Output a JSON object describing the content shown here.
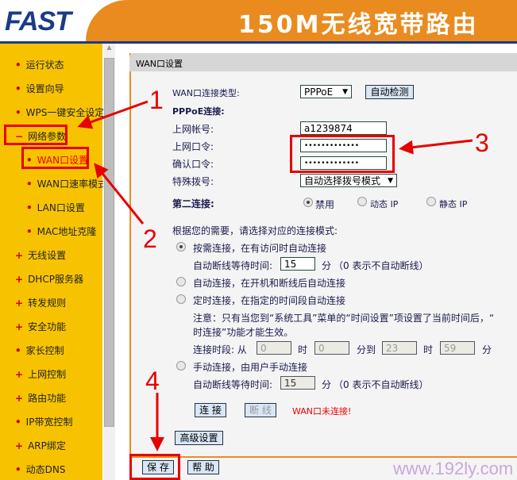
{
  "header": {
    "logo": "FAST",
    "slogan": "150M无线宽带路由"
  },
  "sidebar": {
    "items": [
      {
        "label": "运行状态",
        "bullet": "•"
      },
      {
        "label": "设置向导",
        "bullet": "•"
      },
      {
        "label": "WPS一键安全设定",
        "bullet": "•"
      },
      {
        "label": "网络参数",
        "bullet": "−"
      },
      {
        "label": "WAN口设置",
        "bullet": "•"
      },
      {
        "label": "WAN口速率模式",
        "bullet": "•"
      },
      {
        "label": "LAN口设置",
        "bullet": "•"
      },
      {
        "label": "MAC地址克隆",
        "bullet": "•"
      },
      {
        "label": "无线设置",
        "bullet": "+"
      },
      {
        "label": "DHCP服务器",
        "bullet": "+"
      },
      {
        "label": "转发规则",
        "bullet": "+"
      },
      {
        "label": "安全功能",
        "bullet": "+"
      },
      {
        "label": "家长控制",
        "bullet": "•"
      },
      {
        "label": "上网控制",
        "bullet": "+"
      },
      {
        "label": "路由功能",
        "bullet": "+"
      },
      {
        "label": "IP带宽控制",
        "bullet": "•"
      },
      {
        "label": "ARP绑定",
        "bullet": "+"
      },
      {
        "label": "动态DNS",
        "bullet": "•"
      }
    ]
  },
  "panel": {
    "title": "WAN口设置",
    "conn_type_label": "WAN口连接类型:",
    "conn_type_value": "PPPoE",
    "auto_detect": "自动检测",
    "pppoe_label": "PPPoE连接:",
    "account_label": "上网帐号:",
    "account_value": "a1239874",
    "password_label": "上网口令:",
    "password_value": "•••••••••••••",
    "confirm_label": "确认口令:",
    "confirm_value": "•••••••••••••",
    "special_label": "特殊拨号:",
    "special_value": "自动选择拨号模式",
    "second_label": "第二连接:",
    "second_options": [
      "禁用",
      "动态 IP",
      "静态 IP"
    ],
    "mode_prompt": "根据您的需要，请选择对应的连接模式:",
    "mode1": "按需连接，在有访问时自动连接",
    "wait_label": "自动断线等待时间:",
    "wait1": "15",
    "min": "分",
    "wait_note": "（0 表示不自动断线）",
    "mode2": "自动连接，在开机和断线后自动连接",
    "mode3": "定时连接，在指定的时间段自动连接",
    "note1": "注意：只有当您到“系统工具”菜单的“时间设置”项设置了当前时间后，“",
    "note2": "时连接”功能才能生效。",
    "period_label": "连接时段: 从",
    "from_h": "0",
    "hour": "时",
    "from_m": "0",
    "min_to": "分到",
    "to_h": "23",
    "to_m": "59",
    "mode4": "手动连接，由用户手动连接",
    "wait4": "15",
    "connect": "连 接",
    "disconnect": "断 线",
    "status": "WAN口未连接!",
    "advanced": "高级设置"
  },
  "footer": {
    "save": "保 存",
    "help": "帮 助",
    "watermark": "www.192ly.com"
  },
  "annotations": {
    "n1": "1",
    "n2": "2",
    "n3": "3",
    "n4": "4"
  },
  "colors": {
    "accent": "#e98b1f",
    "sidebar": "#f7c300",
    "annotation": "#e60000",
    "brand": "#1b3a8a"
  }
}
